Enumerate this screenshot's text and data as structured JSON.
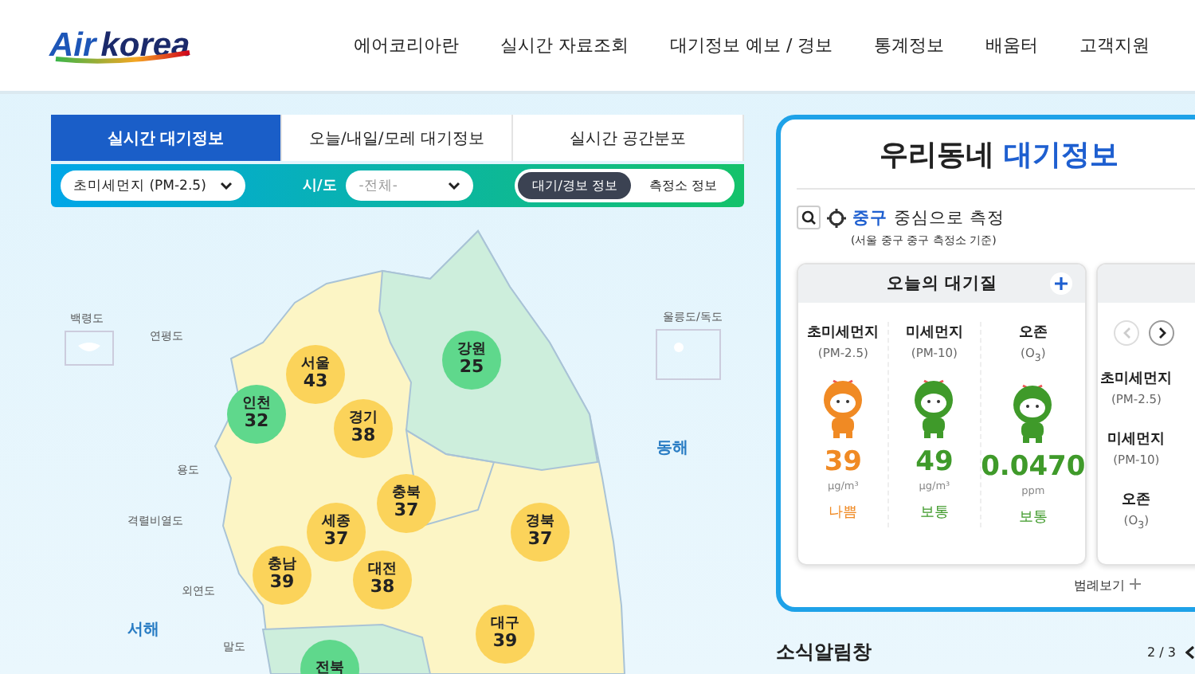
{
  "logo": {
    "part1": "Air",
    "part2": "korea"
  },
  "nav": [
    "에어코리아란",
    "실시간 자료조회",
    "대기정보 예보 / 경보",
    "통계정보",
    "배움터",
    "고객지원"
  ],
  "tabs": [
    {
      "label": "실시간 대기정보",
      "selected": true
    },
    {
      "label": "오늘/내일/모레 대기정보",
      "selected": false
    },
    {
      "label": "실시간 공간분포",
      "selected": false
    }
  ],
  "filter": {
    "pollutant": "초미세먼지 (PM-2.5)",
    "region_label": "시/도",
    "region": "-전체-",
    "toggles": [
      {
        "label": "대기/경보 정보",
        "selected": true
      },
      {
        "label": "측정소 정보",
        "selected": false
      }
    ]
  },
  "map": {
    "regions": [
      {
        "name": "서울",
        "value": "43",
        "color": "#fbd35a"
      },
      {
        "name": "인천",
        "value": "32",
        "color": "#5fd88c"
      },
      {
        "name": "경기",
        "value": "38",
        "color": "#fbd35a"
      },
      {
        "name": "강원",
        "value": "25",
        "color": "#5fd88c"
      },
      {
        "name": "충북",
        "value": "37",
        "color": "#fbd35a"
      },
      {
        "name": "세종",
        "value": "37",
        "color": "#fbd35a"
      },
      {
        "name": "경북",
        "value": "37",
        "color": "#fbd35a"
      },
      {
        "name": "충남",
        "value": "39",
        "color": "#fbd35a"
      },
      {
        "name": "대전",
        "value": "38",
        "color": "#fbd35a"
      },
      {
        "name": "대구",
        "value": "39",
        "color": "#fbd35a"
      },
      {
        "name": "전북",
        "color": "#5fd88c"
      }
    ],
    "places": [
      "백령도",
      "연평도",
      "울릉도/독도",
      "동해",
      "용도",
      "격렬비열도",
      "외연도",
      "서해",
      "말도"
    ]
  },
  "local": {
    "title_a": "우리동네",
    "title_b": "대기정보",
    "location": "중구",
    "location_suffix": "중심으로 측정",
    "basis": "(서울 중구 중구 측정소 기준)",
    "today": {
      "title": "오늘의 대기질",
      "items": [
        {
          "name": "초미세먼지",
          "sub": "(PM-2.5)",
          "value": "39",
          "unit": "μg/m³",
          "grade": "나쁨",
          "color": "#f08a24"
        },
        {
          "name": "미세먼지",
          "sub": "(PM-10)",
          "value": "49",
          "unit": "μg/m³",
          "grade": "보통",
          "color": "#3f9a2a"
        },
        {
          "name": "오존",
          "sub": "(O$_{3}$)",
          "value": "0.0470",
          "unit": "ppm",
          "grade": "보통",
          "color": "#3f9a2a"
        }
      ]
    },
    "legend": "범례보기",
    "next_card": {
      "items": [
        {
          "name": "초미세먼지",
          "sub": "(PM-2.5)"
        },
        {
          "name": "미세먼지",
          "sub": "(PM-10)"
        },
        {
          "name": "오존",
          "sub": "(O$_{3}$)"
        }
      ]
    }
  },
  "notice": {
    "title": "소식알림창",
    "page": "2 / 3"
  }
}
